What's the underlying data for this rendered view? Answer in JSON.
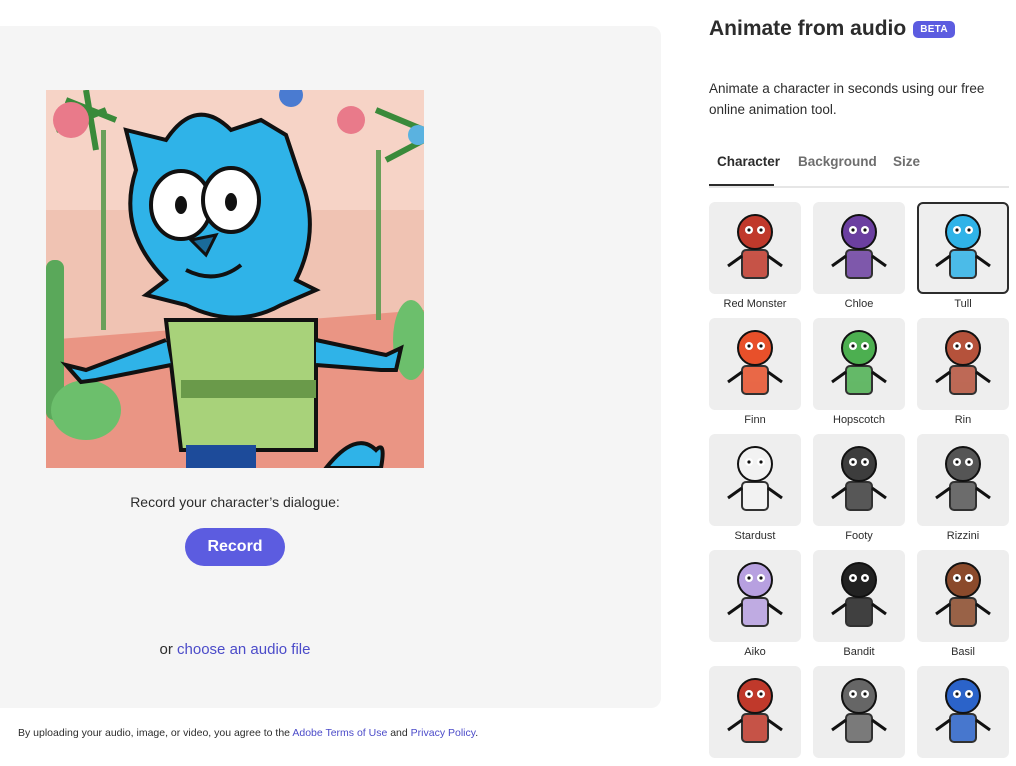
{
  "header": {
    "title": "Animate from audio",
    "badge": "BETA"
  },
  "description": "Animate a character in seconds using our free online animation tool.",
  "tabs": [
    {
      "label": "Character",
      "active": true
    },
    {
      "label": "Background",
      "active": false
    },
    {
      "label": "Size",
      "active": false
    }
  ],
  "characters": [
    {
      "name": "Red Monster",
      "color": "#c0392b"
    },
    {
      "name": "Chloe",
      "color": "#6b3fa0"
    },
    {
      "name": "Tull",
      "color": "#2fb3e8",
      "selected": true
    },
    {
      "name": "Finn",
      "color": "#e8502a"
    },
    {
      "name": "Hopscotch",
      "color": "#4caf50"
    },
    {
      "name": "Rin",
      "color": "#b5523b"
    },
    {
      "name": "Stardust",
      "color": "#f2f2f2"
    },
    {
      "name": "Footy",
      "color": "#3d3d3d"
    },
    {
      "name": "Rizzini",
      "color": "#555555"
    },
    {
      "name": "Aiko",
      "color": "#b7a0e0"
    },
    {
      "name": "Bandit",
      "color": "#222222"
    },
    {
      "name": "Basil",
      "color": "#8b4a2b"
    },
    {
      "name": "",
      "color": "#c0392b"
    },
    {
      "name": "",
      "color": "#666666"
    },
    {
      "name": "",
      "color": "#2b63c9"
    }
  ],
  "record": {
    "prompt": "Record your character’s dialogue:",
    "button_label": "Record",
    "or_text": "or",
    "audio_link": "choose an audio file"
  },
  "legal": {
    "text": "By uploading your audio, image, or video, you agree to the",
    "terms_link": "Adobe Terms of Use",
    "and_text": "and",
    "privacy_link": "Privacy Policy",
    "end": "."
  },
  "colors": {
    "accent": "#5c5ce0",
    "link": "#4b4bc9",
    "panel_bg": "#f5f5f5"
  }
}
